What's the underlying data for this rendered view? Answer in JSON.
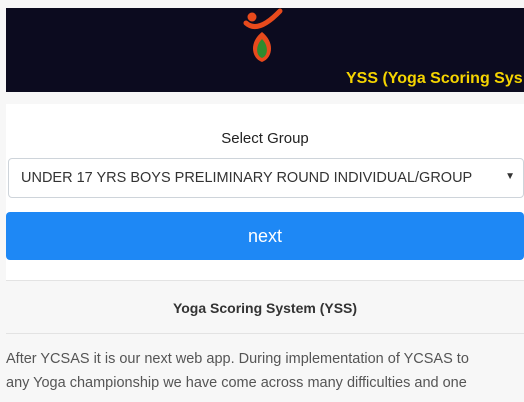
{
  "header": {
    "logo_icon": "yoga-figure-logo-icon",
    "app_title": "YSS (Yoga Scoring Sys",
    "title_color": "#f5d400",
    "background": "#0c0b1f"
  },
  "form": {
    "select_label": "Select Group",
    "selected_group": "UNDER 17 YRS BOYS PRELIMINARY ROUND INDIVIDUAL/GROUP",
    "arrow_glyph": "▼",
    "next_label": "next",
    "button_color": "#1e88f5"
  },
  "about": {
    "title": "Yoga Scoring System (YSS)",
    "description": "After YCSAS it is our next web app. During implementation of YCSAS to\nany Yoga championship we have come across many difficulties and one"
  }
}
